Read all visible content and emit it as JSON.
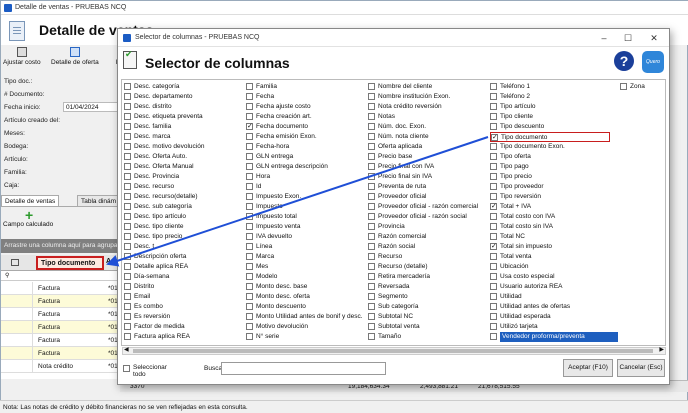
{
  "background_window": {
    "title": "Detalle de ventas - PRUEBAS NCQ",
    "header_title": "Detalle de ventas",
    "toolbar": {
      "ajustar": "Ajustar costo",
      "detalle": "Detalle de oferta",
      "more": "E"
    },
    "form": {
      "tipo_doc": "Tipo doc.:",
      "num_doc": "# Documento:",
      "fecha_inicio": "Fecha inicio:",
      "fecha_inicio_value": "01/04/2024",
      "articulo_creado": "Artículo creado del:",
      "meses": "Meses:",
      "bodega": "Bodega:",
      "articulo": "Artículo:",
      "familia": "Familia:",
      "caja": "Caja:"
    },
    "tabs": [
      "Detalle de ventas",
      "Tabla dinám"
    ],
    "campo_calculado": "Campo calculado",
    "group_bar": "Arrastre una columna aquí para agrupar",
    "grid": {
      "col_header": "Tipo documento",
      "col_header2": "Ar",
      "rows": [
        {
          "tipo": "Factura",
          "ar": "*01",
          "yellow": false
        },
        {
          "tipo": "Factura",
          "ar": "*01",
          "yellow": true
        },
        {
          "tipo": "Factura",
          "ar": "*01",
          "yellow": false
        },
        {
          "tipo": "Factura",
          "ar": "*01",
          "yellow": true
        },
        {
          "tipo": "Factura",
          "ar": "*01",
          "yellow": false
        },
        {
          "tipo": "Factura",
          "ar": "*01",
          "yellow": true
        },
        {
          "tipo": "Nota crédito",
          "ar": "*01",
          "yellow": false
        }
      ]
    },
    "totals": {
      "count": "3370",
      "t1": "19,184,634.34",
      "t2": "2,493,881.21",
      "t3": "21,678,515.55"
    },
    "status": "Nota: Las notas de crédito y débito financieras no se ven reflejadas en esta consulta."
  },
  "dialog": {
    "window_title": "Selector de columnas - PRUEBAS NCQ",
    "title": "Selector de columnas",
    "help": "?",
    "logo": "Quero",
    "columns": [
      [
        {
          "label": "Desc. categoría",
          "checked": false
        },
        {
          "label": "Desc. departamento",
          "checked": false
        },
        {
          "label": "Desc. distrito",
          "checked": false
        },
        {
          "label": "Desc. etiqueta preventa",
          "checked": false
        },
        {
          "label": "Desc. familia",
          "checked": false
        },
        {
          "label": "Desc. marca",
          "checked": false
        },
        {
          "label": "Desc. motivo devolución",
          "checked": false
        },
        {
          "label": "Desc. Oferta Auto.",
          "checked": false
        },
        {
          "label": "Desc. Oferta Manual",
          "checked": false
        },
        {
          "label": "Desc. Provincia",
          "checked": false
        },
        {
          "label": "Desc. recurso",
          "checked": false
        },
        {
          "label": "Desc. recurso(detalle)",
          "checked": false
        },
        {
          "label": "Desc. sub categoría",
          "checked": false
        },
        {
          "label": "Desc. tipo artículo",
          "checked": false
        },
        {
          "label": "Desc. tipo cliente",
          "checked": false
        },
        {
          "label": "Desc. tipo precio",
          "checked": false
        },
        {
          "label": "Desc. t",
          "checked": false
        },
        {
          "label": "Descripción oferta",
          "checked": false
        },
        {
          "label": "Detalle aplica REA",
          "checked": false
        },
        {
          "label": "Día-semana",
          "checked": false
        },
        {
          "label": "Distrito",
          "checked": false
        },
        {
          "label": "Email",
          "checked": false
        },
        {
          "label": "Es combo",
          "checked": false
        },
        {
          "label": "Es reversión",
          "checked": false
        },
        {
          "label": "Factor de medida",
          "checked": false
        },
        {
          "label": "Factura aplica REA",
          "checked": false
        }
      ],
      [
        {
          "label": "Familia",
          "checked": false
        },
        {
          "label": "Fecha",
          "checked": false
        },
        {
          "label": "Fecha ajuste costo",
          "checked": false
        },
        {
          "label": "Fecha creación art.",
          "checked": false
        },
        {
          "label": "Fecha documento",
          "checked": true
        },
        {
          "label": "Fecha emisión Exon.",
          "checked": false
        },
        {
          "label": "Fecha-hora",
          "checked": false
        },
        {
          "label": "GLN entrega",
          "checked": false
        },
        {
          "label": "GLN entrega descripción",
          "checked": false
        },
        {
          "label": "Hora",
          "checked": false
        },
        {
          "label": "Id",
          "checked": false
        },
        {
          "label": "Impuesto Exon.",
          "checked": false
        },
        {
          "label": "Impuesto",
          "checked": false
        },
        {
          "label": "Impuesto total",
          "checked": false
        },
        {
          "label": "Impuesto venta",
          "checked": false
        },
        {
          "label": "IVA devuelto",
          "checked": false
        },
        {
          "label": "Línea",
          "checked": false
        },
        {
          "label": "Marca",
          "checked": false
        },
        {
          "label": "Mes",
          "checked": false
        },
        {
          "label": "Modelo",
          "checked": false
        },
        {
          "label": "Monto desc. base",
          "checked": false
        },
        {
          "label": "Monto desc. oferta",
          "checked": false
        },
        {
          "label": "Monto descuento",
          "checked": false
        },
        {
          "label": "Monto Utilidad antes de bonif y desc.",
          "checked": false
        },
        {
          "label": "Motivo devolución",
          "checked": false
        },
        {
          "label": "N° serie",
          "checked": false
        }
      ],
      [
        {
          "label": "Nombre del cliente",
          "checked": false
        },
        {
          "label": "Nombre institución Exon.",
          "checked": false
        },
        {
          "label": "Nota crédito reversión",
          "checked": false
        },
        {
          "label": "Notas",
          "checked": false
        },
        {
          "label": "Núm. doc. Exon.",
          "checked": false
        },
        {
          "label": "Núm. nota cliente",
          "checked": false
        },
        {
          "label": "Oferta aplicada",
          "checked": false
        },
        {
          "label": "Precio base",
          "checked": false
        },
        {
          "label": "Precio final con IVA",
          "checked": false
        },
        {
          "label": "Precio final sin IVA",
          "checked": false
        },
        {
          "label": "Preventa de ruta",
          "checked": false
        },
        {
          "label": "Proveedor oficial",
          "checked": false
        },
        {
          "label": "Proveedor oficial - razón comercial",
          "checked": false
        },
        {
          "label": "Proveedor oficial - razón social",
          "checked": false
        },
        {
          "label": "Provincia",
          "checked": false
        },
        {
          "label": "Razón comercial",
          "checked": false
        },
        {
          "label": "Razón social",
          "checked": false
        },
        {
          "label": "Recurso",
          "checked": false
        },
        {
          "label": "Recurso (detalle)",
          "checked": false
        },
        {
          "label": "Retira mercadería",
          "checked": false
        },
        {
          "label": "Reversada",
          "checked": false
        },
        {
          "label": "Segmento",
          "checked": false
        },
        {
          "label": "Sub categoría",
          "checked": false
        },
        {
          "label": "Subtotal NC",
          "checked": false
        },
        {
          "label": "Subtotal venta",
          "checked": false
        },
        {
          "label": "Tamaño",
          "checked": false
        }
      ],
      [
        {
          "label": "Teléfono 1",
          "checked": false
        },
        {
          "label": "Teléfono 2",
          "checked": false
        },
        {
          "label": "Tipo artículo",
          "checked": false
        },
        {
          "label": "Tipo cliente",
          "checked": false
        },
        {
          "label": "Tipo descuento",
          "checked": false
        },
        {
          "label": "Tipo documento",
          "checked": true,
          "highlight": true
        },
        {
          "label": "Tipo documento Exon.",
          "checked": false
        },
        {
          "label": "Tipo oferta",
          "checked": false
        },
        {
          "label": "Tipo pago",
          "checked": false
        },
        {
          "label": "Tipo precio",
          "checked": false
        },
        {
          "label": "Tipo proveedor",
          "checked": false
        },
        {
          "label": "Tipo reversión",
          "checked": false
        },
        {
          "label": "Total + IVA",
          "checked": true
        },
        {
          "label": "Total costo con IVA",
          "checked": false
        },
        {
          "label": "Total costo sin IVA",
          "checked": false
        },
        {
          "label": "Total NC",
          "checked": false
        },
        {
          "label": "Total sin impuesto",
          "checked": true
        },
        {
          "label": "Total venta",
          "checked": false
        },
        {
          "label": "Ubicación",
          "checked": false
        },
        {
          "label": "Usa costo especial",
          "checked": false
        },
        {
          "label": "Usuario autoriza REA",
          "checked": false
        },
        {
          "label": "Utilidad",
          "checked": false
        },
        {
          "label": "Utilidad antes de ofertas",
          "checked": false
        },
        {
          "label": "Utilidad esperada",
          "checked": false
        },
        {
          "label": "Utilizó tarjeta",
          "checked": false
        },
        {
          "label": "Vendedor proforma/preventa",
          "checked": false,
          "selected": true
        }
      ],
      [
        {
          "label": "Zona",
          "checked": false
        }
      ]
    ],
    "footer": {
      "select_all": "Seleccionar todo",
      "buscar_label": "Buscar:",
      "buscar_value": "",
      "accept": "Aceptar (F10)",
      "cancel": "Cancelar (Esc)"
    }
  }
}
